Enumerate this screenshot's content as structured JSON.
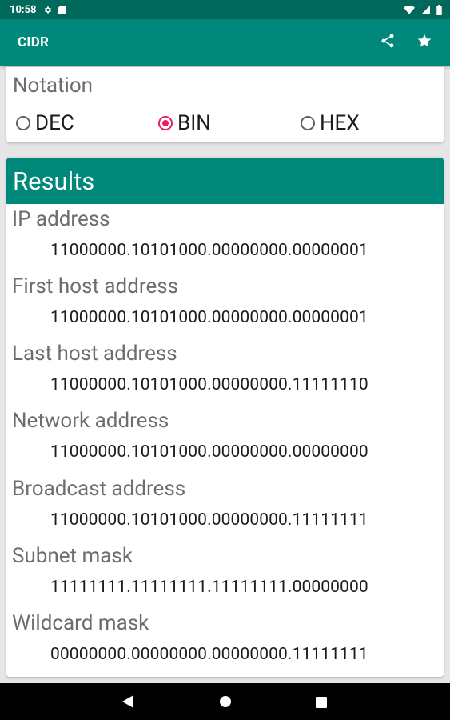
{
  "status_bar": {
    "time": "10:58"
  },
  "app_bar": {
    "title": "CIDR"
  },
  "notation": {
    "title": "Notation",
    "options": [
      {
        "label": "DEC",
        "checked": false
      },
      {
        "label": "BIN",
        "checked": true
      },
      {
        "label": "HEX",
        "checked": false
      }
    ]
  },
  "results": {
    "title": "Results",
    "items": [
      {
        "label": "IP address",
        "value": "11000000.10101000.00000000.00000001"
      },
      {
        "label": "First host address",
        "value": "11000000.10101000.00000000.00000001"
      },
      {
        "label": "Last host address",
        "value": "11000000.10101000.00000000.11111110"
      },
      {
        "label": "Network address",
        "value": "11000000.10101000.00000000.00000000"
      },
      {
        "label": "Broadcast address",
        "value": "11000000.10101000.00000000.11111111"
      },
      {
        "label": "Subnet mask",
        "value": "11111111.11111111.11111111.00000000"
      },
      {
        "label": "Wildcard mask",
        "value": "00000000.00000000.00000000.11111111"
      }
    ]
  },
  "colors": {
    "primary": "#00897b",
    "primary_dark": "#00695c",
    "accent": "#e91e63"
  }
}
